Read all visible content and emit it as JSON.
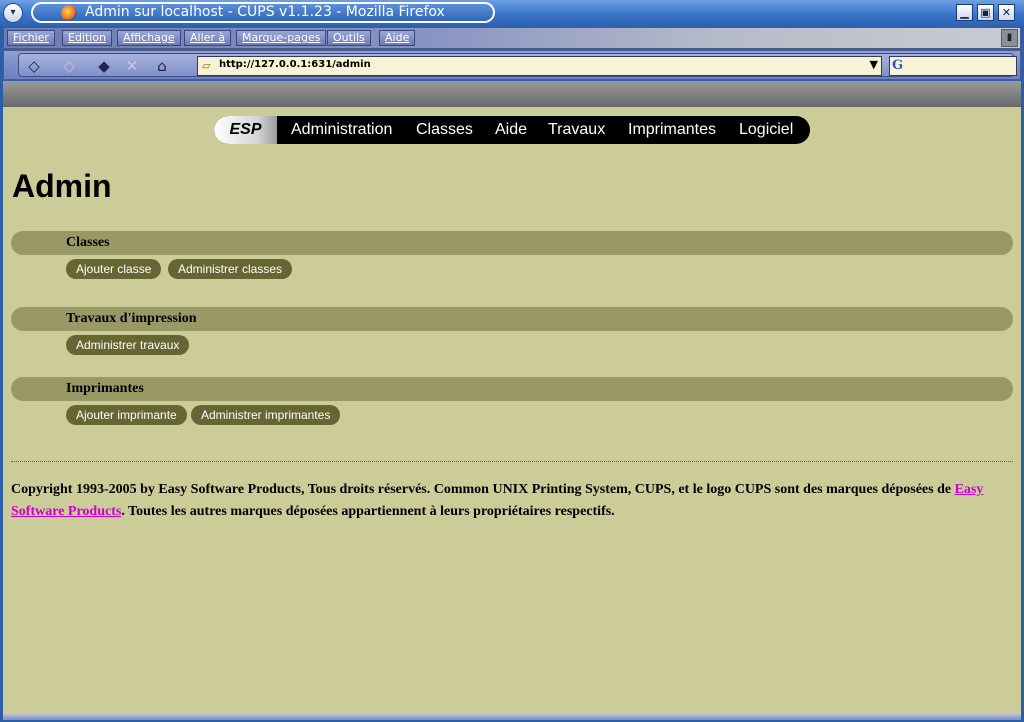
{
  "window": {
    "title": "Admin sur localhost - CUPS v1.1.23 - Mozilla Firefox",
    "controls": {
      "minimize": "▁",
      "maximize": "▣",
      "close": "✕"
    },
    "menu_glyph": "▾"
  },
  "menubar": {
    "items": [
      "Fichier",
      "Edition",
      "Affichage",
      "Aller à",
      "Marque-pages",
      "Outils",
      "Aide"
    ]
  },
  "navbar": {
    "back": "◇",
    "forward": "◇",
    "reload": "◆",
    "stop": "✕",
    "home": "⌂",
    "url": "http://127.0.0.1:631/admin",
    "url_drop": "▼",
    "search_engine": "G",
    "search_value": ""
  },
  "topnav": {
    "brand": "ESP",
    "links": [
      "Administration",
      "Classes",
      "Aide",
      "Travaux",
      "Imprimantes",
      "Logiciel"
    ]
  },
  "page": {
    "title": "Admin",
    "sections": [
      {
        "title": "Classes",
        "buttons": [
          "Ajouter classe",
          "Administrer classes"
        ]
      },
      {
        "title": "Travaux d'impression",
        "buttons": [
          "Administrer travaux"
        ]
      },
      {
        "title": "Imprimantes",
        "buttons": [
          "Ajouter imprimante",
          "Administrer imprimantes"
        ]
      }
    ]
  },
  "footer": {
    "text_before": "Copyright 1993-2005 by Easy Software Products, Tous droits réservés. Common UNIX Printing System, CUPS, et le logo CUPS sont des marques déposées de ",
    "link": "Easy Software Products",
    "text_after": ". Toutes les autres marques déposées appartiennent à leurs propriétaires respectifs."
  },
  "colors": {
    "content_bg": "#cccc99",
    "section_bar": "#999966",
    "button_bg": "#666633",
    "link": "#cc00cc"
  }
}
